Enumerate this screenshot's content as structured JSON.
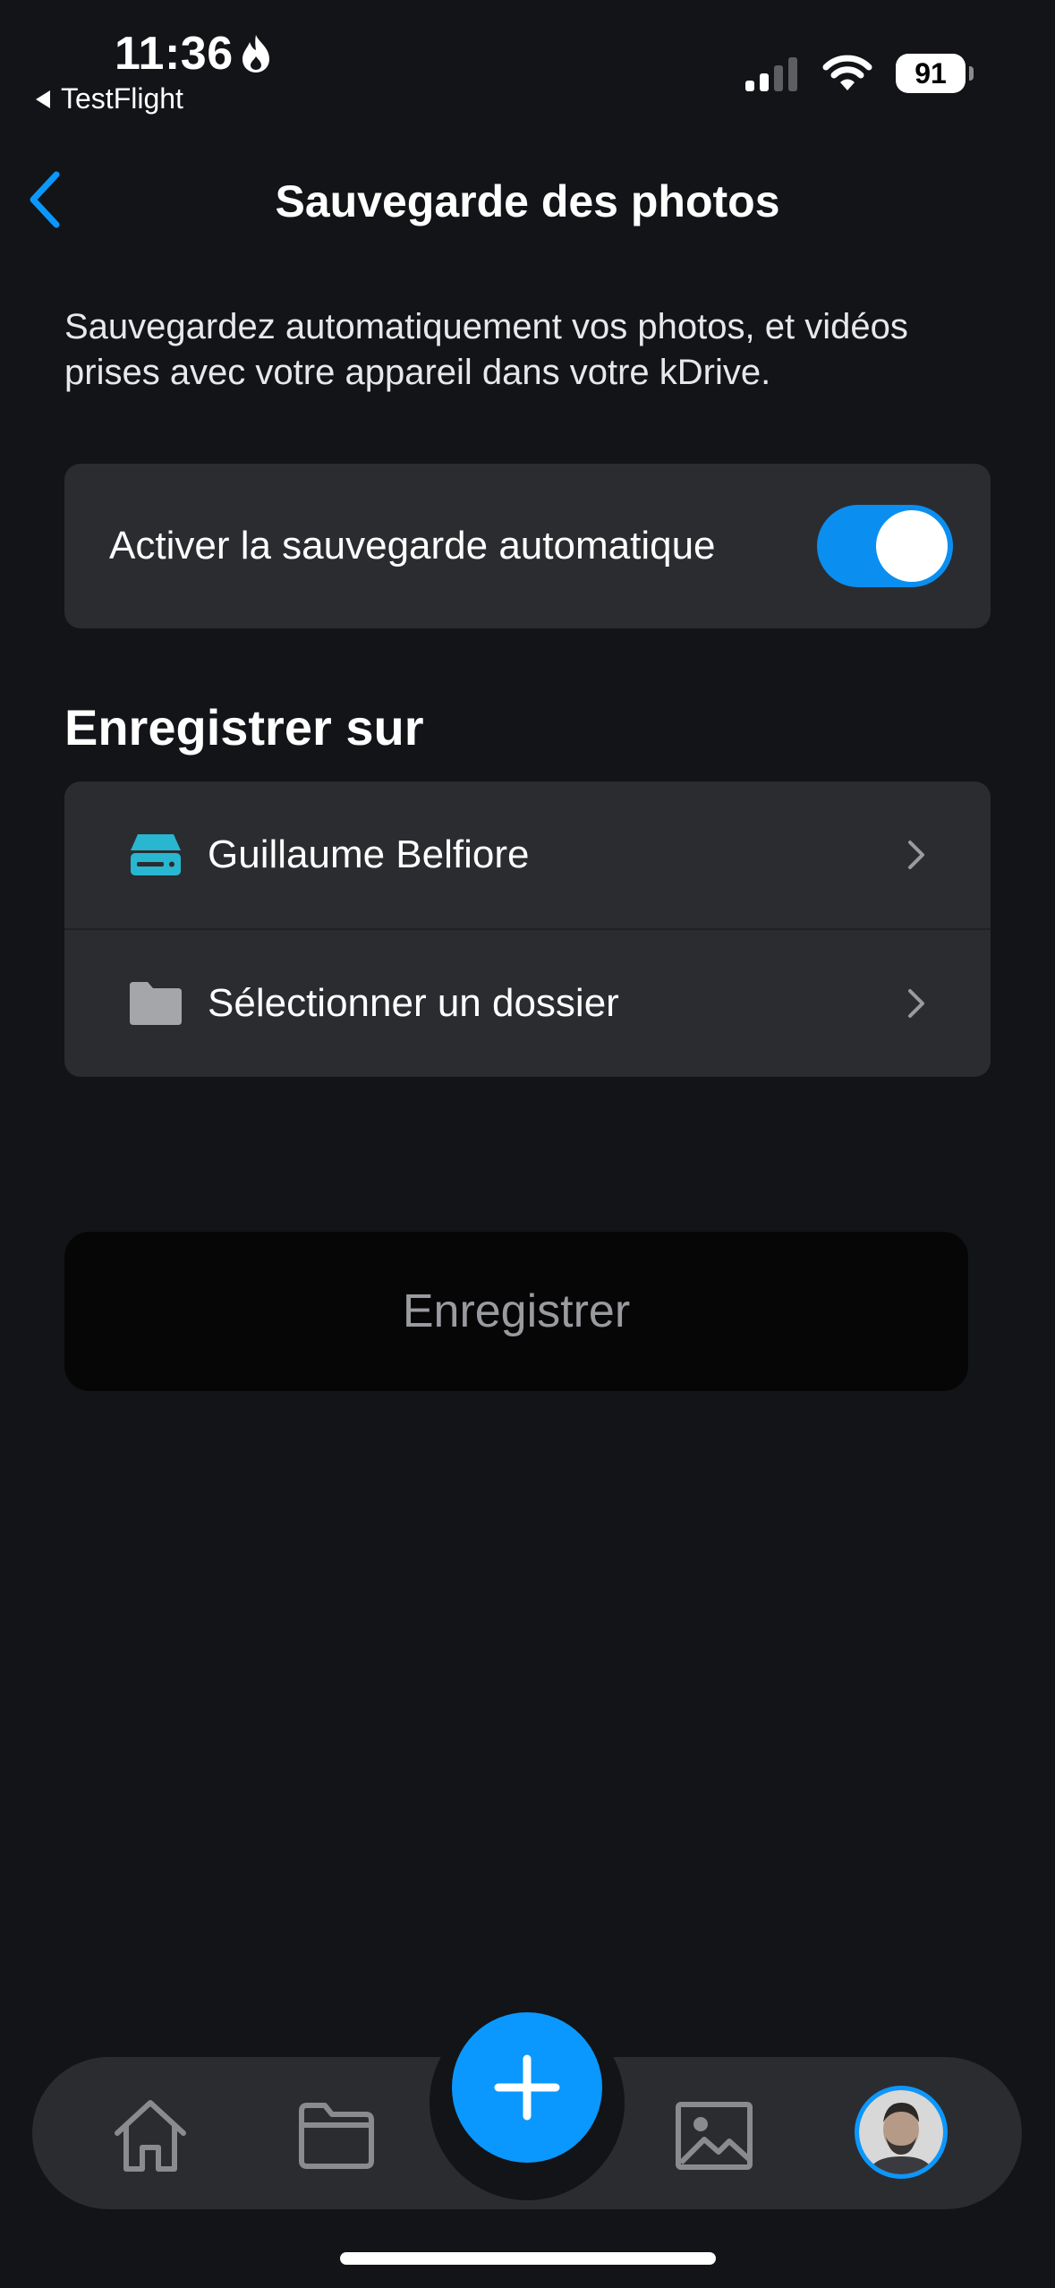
{
  "status_bar": {
    "time": "11:36",
    "back_app": "TestFlight",
    "battery": "91"
  },
  "header": {
    "title": "Sauvegarde des photos"
  },
  "description": "Sauvegardez automatiquement vos photos, et vidéos prises avec votre appareil dans votre kDrive.",
  "auto_backup": {
    "label": "Activer la sauvegarde automatique",
    "enabled": true
  },
  "destination": {
    "heading": "Enregistrer sur",
    "drive_label": "Guillaume Belfiore",
    "folder_label": "Sélectionner un dossier"
  },
  "save_button": "Enregistrer",
  "tabbar": {
    "icons": [
      "home-icon",
      "folder-icon",
      "plus-icon",
      "gallery-icon",
      "avatar"
    ]
  },
  "colors": {
    "accent": "#0A98FF",
    "drive_icon": "#29B6D0",
    "background": "#131417",
    "card": "#2B2C30"
  }
}
